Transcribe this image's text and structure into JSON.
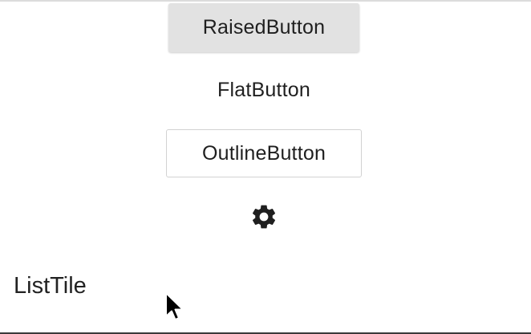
{
  "buttons": {
    "raised_label": "RaisedButton",
    "flat_label": "FlatButton",
    "outline_label": "OutlineButton"
  },
  "icon_button": {
    "icon": "gear-icon"
  },
  "list_tile": {
    "title": "ListTile"
  },
  "colors": {
    "raised_background": "#e2e2e2",
    "outline_border": "#d2d2d2",
    "text": "#1f1f1f",
    "icon": "#1f1f1f"
  }
}
